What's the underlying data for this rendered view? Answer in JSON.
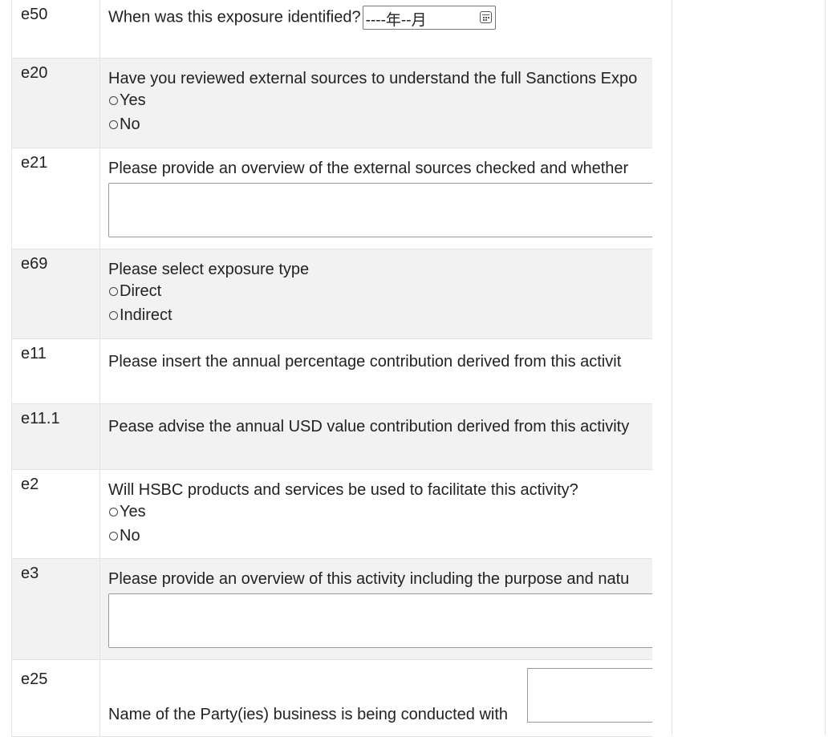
{
  "rows": [
    {
      "id": "e50",
      "question": "When was this exposure identified?",
      "date_value": "----年--月"
    },
    {
      "id": "e20",
      "question": "Have you reviewed external sources to understand the full Sanctions Expo",
      "options": [
        "Yes",
        "No"
      ]
    },
    {
      "id": "e21",
      "question": "Please provide an overview of the external sources checked and whether"
    },
    {
      "id": "e69",
      "question": "Please select exposure type",
      "options": [
        "Direct",
        "Indirect"
      ]
    },
    {
      "id": "e11",
      "question": "Please insert the annual percentage contribution derived from this activit"
    },
    {
      "id": "e11.1",
      "question": "Pease advise the annual USD value contribution derived from this activity"
    },
    {
      "id": "e2",
      "question": "Will HSBC products and services be used to facilitate this activity?",
      "options": [
        "Yes",
        "No"
      ]
    },
    {
      "id": "e3",
      "question": "Please provide an overview of this activity including the purpose and natu"
    },
    {
      "id": "e25",
      "question": "Name of the Party(ies) business is being conducted with"
    }
  ]
}
